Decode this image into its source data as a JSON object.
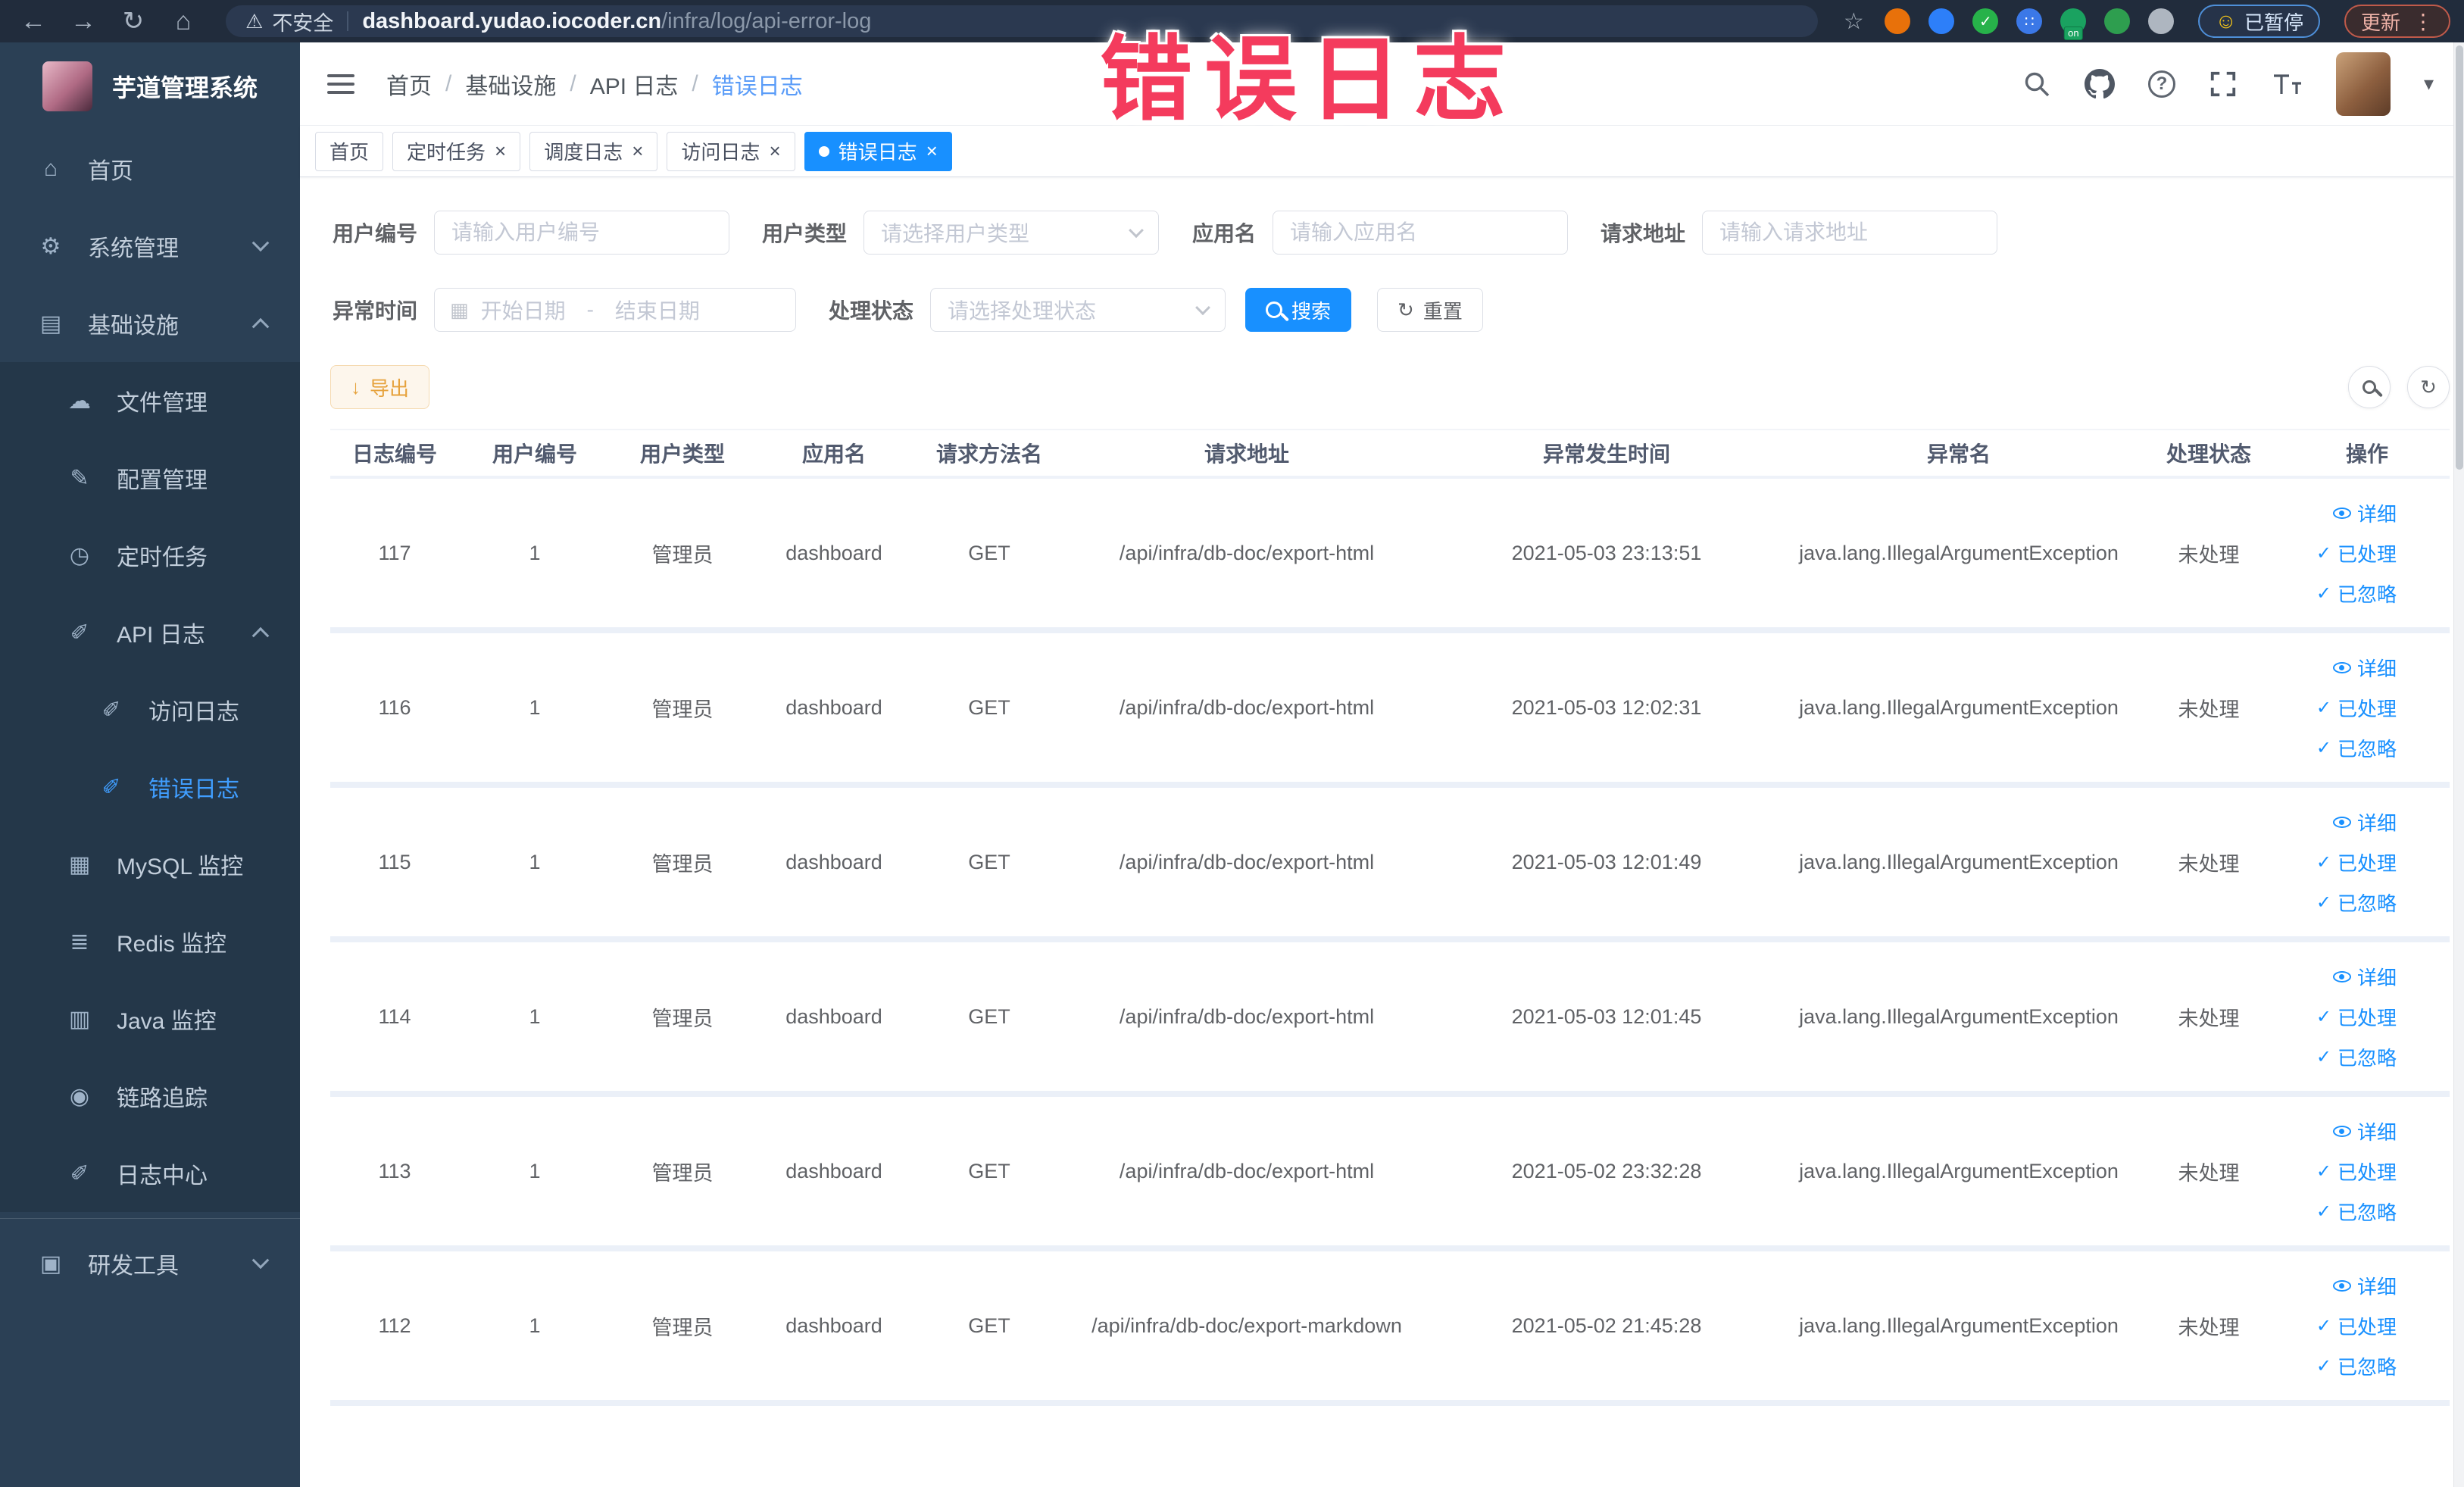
{
  "browser": {
    "security_label": "不安全",
    "url_host": "dashboard.yudao.iocoder.cn",
    "url_path": "/infra/log/api-error-log",
    "paused_label": "已暂停",
    "update_label": "更新",
    "extensions": [
      {
        "name": "bookmark-star-icon",
        "type": "glyph",
        "glyph": "☆",
        "color": "#a8b2bd"
      },
      {
        "name": "ext-orange-icon",
        "type": "dot",
        "color": "#e8710a"
      },
      {
        "name": "ext-blue-drop-icon",
        "type": "dot",
        "color": "#2d7ff9"
      },
      {
        "name": "ext-green-check-icon",
        "type": "dot",
        "color": "#27b24a",
        "glyph": "✓"
      },
      {
        "name": "ext-grid-icon",
        "type": "dot",
        "color": "#3b78e7",
        "glyph": "∷"
      },
      {
        "name": "ext-on-badge-icon",
        "type": "dot",
        "color": "#1aa260",
        "badge": "on"
      },
      {
        "name": "ext-leaf-icon",
        "type": "dot",
        "color": "#2e9e4f"
      },
      {
        "name": "extensions-puzzle-icon",
        "type": "dot",
        "color": "#aeb6c0"
      }
    ]
  },
  "icons": {
    "back": "←",
    "forward": "→",
    "reload": "↻",
    "home": "⌂",
    "warning": "⚠",
    "smiley": "☺",
    "kebab": "⋮",
    "caret": "▾",
    "download": "↓",
    "refresh": "↻",
    "calendar": "▦",
    "question": "?",
    "separator": "/",
    "close": "×",
    "check": "✓"
  },
  "overlay_title": "错误日志",
  "sidebar": {
    "title": "芋道管理系统",
    "items": [
      {
        "name": "sidebar-item-home",
        "icon": "home-icon",
        "glyph": "⌂",
        "label": "首页",
        "level": 0
      },
      {
        "name": "sidebar-item-system",
        "icon": "gear-icon",
        "glyph": "⚙",
        "label": "系统管理",
        "level": 0,
        "chevron": "down"
      },
      {
        "name": "sidebar-item-infra",
        "icon": "monitor-icon",
        "glyph": "▤",
        "label": "基础设施",
        "level": 0,
        "chevron": "up"
      },
      {
        "name": "sidebar-item-file-manage",
        "icon": "cloud-upload-icon",
        "glyph": "☁",
        "label": "文件管理",
        "level": 1
      },
      {
        "name": "sidebar-item-config-manage",
        "icon": "edit-icon",
        "glyph": "✎",
        "label": "配置管理",
        "level": 1
      },
      {
        "name": "sidebar-item-scheduled-jobs",
        "icon": "timer-icon",
        "glyph": "◷",
        "label": "定时任务",
        "level": 1
      },
      {
        "name": "sidebar-item-api-log",
        "icon": "doc-edit-icon",
        "glyph": "✐",
        "label": "API 日志",
        "level": 1,
        "chevron": "up"
      },
      {
        "name": "sidebar-item-access-log",
        "icon": "doc-edit-icon",
        "glyph": "✐",
        "label": "访问日志",
        "level": 2
      },
      {
        "name": "sidebar-item-error-log",
        "icon": "doc-edit-icon",
        "glyph": "✐",
        "label": "错误日志",
        "level": 2,
        "active": true
      },
      {
        "name": "sidebar-item-mysql-monitor",
        "icon": "grid-icon",
        "glyph": "▦",
        "label": "MySQL 监控",
        "level": 1
      },
      {
        "name": "sidebar-item-redis-monitor",
        "icon": "stack-icon",
        "glyph": "≣",
        "label": "Redis 监控",
        "level": 1
      },
      {
        "name": "sidebar-item-java-monitor",
        "icon": "screen-icon",
        "glyph": "▥",
        "label": "Java 监控",
        "level": 1
      },
      {
        "name": "sidebar-item-trace",
        "icon": "eye-icon",
        "glyph": "◉",
        "label": "链路追踪",
        "level": 1
      },
      {
        "name": "sidebar-item-log-center",
        "icon": "doc-edit-icon",
        "glyph": "✐",
        "label": "日志中心",
        "level": 1
      },
      {
        "divider": true
      },
      {
        "name": "sidebar-item-devtools",
        "icon": "toolbox-icon",
        "glyph": "▣",
        "label": "研发工具",
        "level": 0,
        "chevron": "down"
      }
    ]
  },
  "header": {
    "breadcrumb": [
      "首页",
      "基础设施",
      "API 日志",
      "错误日志"
    ]
  },
  "tags": {
    "items": [
      {
        "label": "首页",
        "closable": false,
        "active": false
      },
      {
        "label": "定时任务",
        "closable": true,
        "active": false
      },
      {
        "label": "调度日志",
        "closable": true,
        "active": false
      },
      {
        "label": "访问日志",
        "closable": true,
        "active": false
      },
      {
        "label": "错误日志",
        "closable": true,
        "active": true
      }
    ]
  },
  "filters": {
    "user_id": {
      "label": "用户编号",
      "placeholder": "请输入用户编号"
    },
    "user_type": {
      "label": "用户类型",
      "placeholder": "请选择用户类型"
    },
    "app_name": {
      "label": "应用名",
      "placeholder": "请输入应用名"
    },
    "request_url": {
      "label": "请求地址",
      "placeholder": "请输入请求地址"
    },
    "exception_time": {
      "label": "异常时间",
      "start_placeholder": "开始日期",
      "separator": "-",
      "end_placeholder": "结束日期"
    },
    "process_status": {
      "label": "处理状态",
      "placeholder": "请选择处理状态"
    },
    "search_label": "搜索",
    "reset_label": "重置"
  },
  "toolbar": {
    "export_label": "导出"
  },
  "table": {
    "columns": [
      "日志编号",
      "用户编号",
      "用户类型",
      "应用名",
      "请求方法名",
      "请求地址",
      "异常发生时间",
      "异常名",
      "处理状态",
      "操作"
    ],
    "actions": [
      "详细",
      "已处理",
      "已忽略"
    ],
    "rows": [
      [
        "117",
        "1",
        "管理员",
        "dashboard",
        "GET",
        "/api/infra/db-doc/export-html",
        "2021-05-03 23:13:51",
        "java.lang.IllegalArgumentException",
        "未处理"
      ],
      [
        "116",
        "1",
        "管理员",
        "dashboard",
        "GET",
        "/api/infra/db-doc/export-html",
        "2021-05-03 12:02:31",
        "java.lang.IllegalArgumentException",
        "未处理"
      ],
      [
        "115",
        "1",
        "管理员",
        "dashboard",
        "GET",
        "/api/infra/db-doc/export-html",
        "2021-05-03 12:01:49",
        "java.lang.IllegalArgumentException",
        "未处理"
      ],
      [
        "114",
        "1",
        "管理员",
        "dashboard",
        "GET",
        "/api/infra/db-doc/export-html",
        "2021-05-03 12:01:45",
        "java.lang.IllegalArgumentException",
        "未处理"
      ],
      [
        "113",
        "1",
        "管理员",
        "dashboard",
        "GET",
        "/api/infra/db-doc/export-html",
        "2021-05-02 23:32:28",
        "java.lang.IllegalArgumentException",
        "未处理"
      ],
      [
        "112",
        "1",
        "管理员",
        "dashboard",
        "GET",
        "/api/infra/db-doc/export-markdown",
        "2021-05-02 21:45:28",
        "java.lang.IllegalArgumentException",
        "未处理"
      ]
    ]
  },
  "colors": {
    "accent": "#1890ff",
    "warning": "#e6a23c",
    "overlay": "#f43b5d",
    "sidebar_bg": "#2b4055"
  }
}
